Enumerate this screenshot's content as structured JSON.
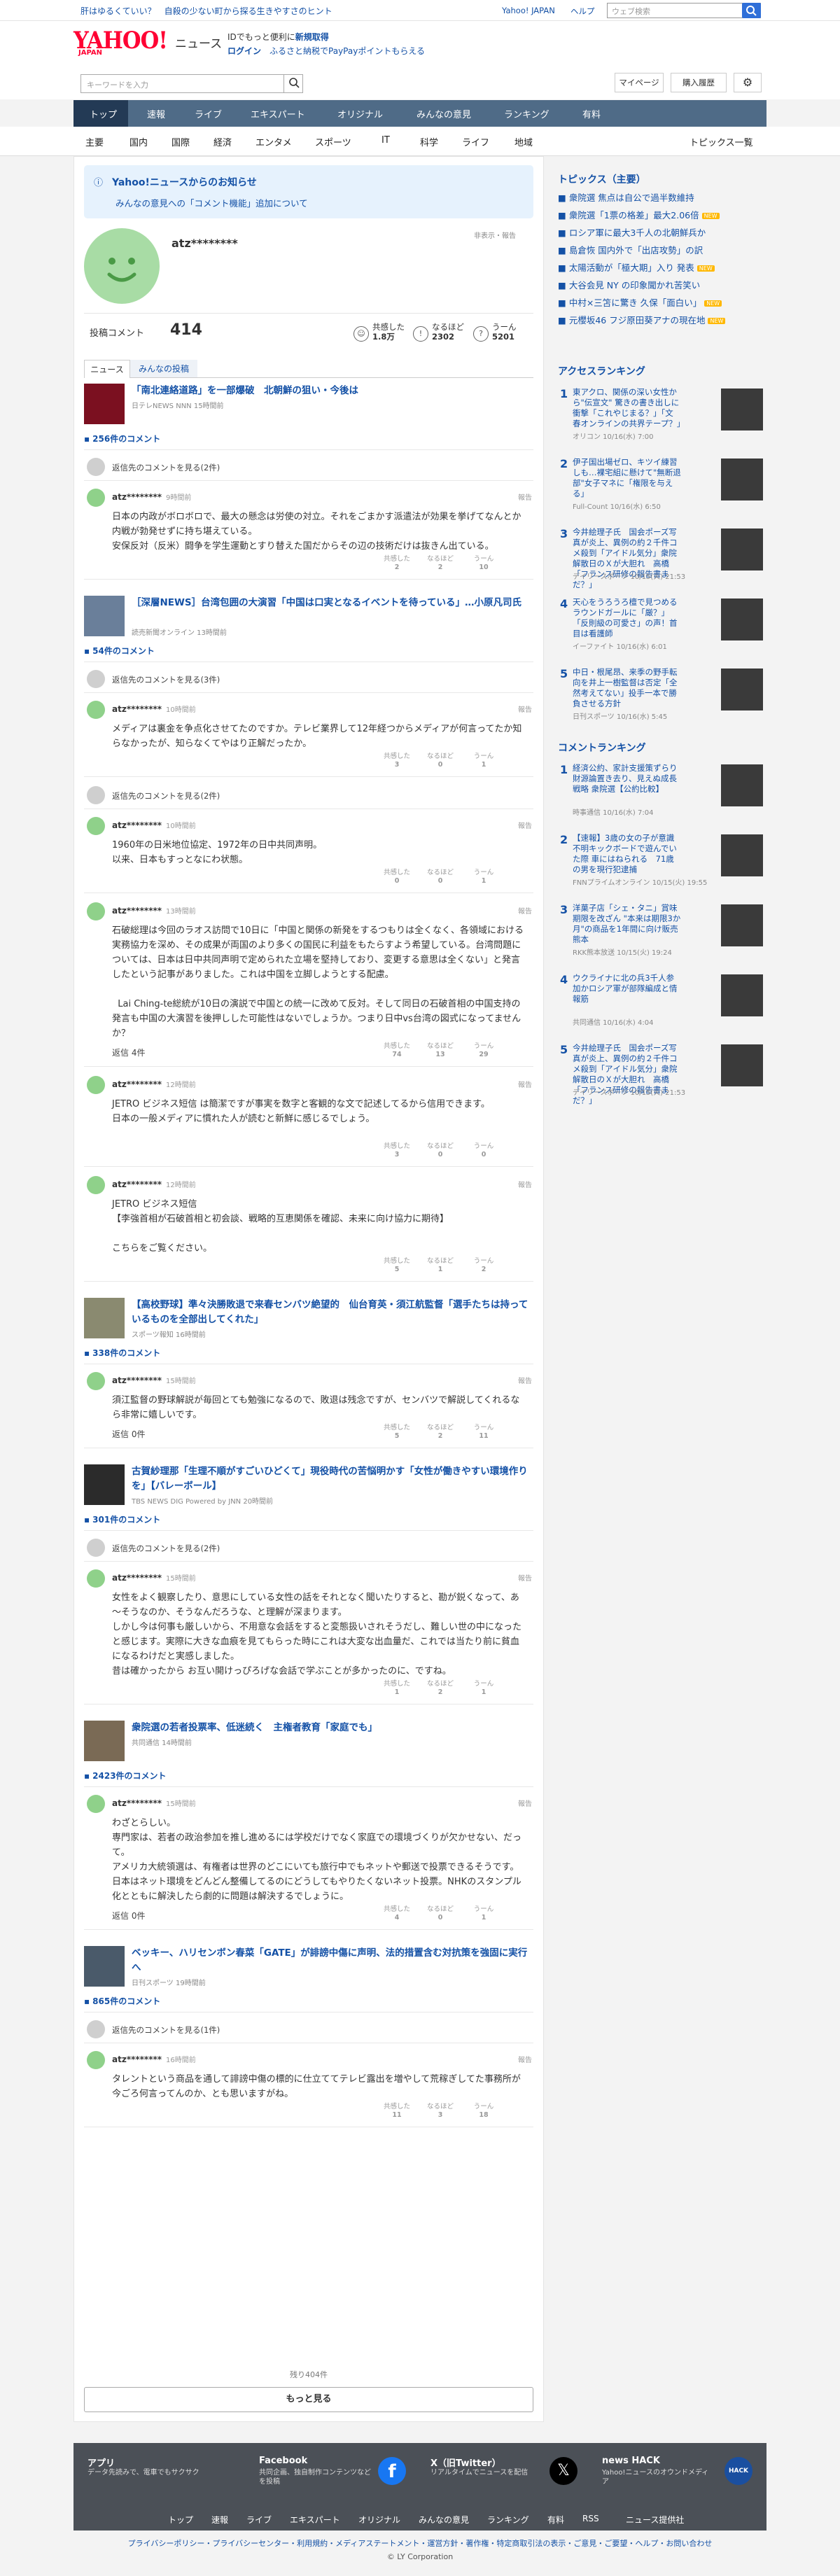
{
  "topbar": {
    "promo": "肝はゆるくていい？　自殺の少ない町から探る生きやすさのヒント",
    "yjapan": "Yahoo! JAPAN",
    "help": "ヘルプ",
    "search_placeholder": "ウェブ検索"
  },
  "header": {
    "logo": "YAHOO!",
    "logo_sub": "JAPAN",
    "section": "ニュース",
    "promo1_a": "IDでもっと便利に",
    "promo1_b": "新規取得",
    "promo2_a": "ログイン",
    "promo2_b": "ふるさと納税でPayPayポイントもらえる"
  },
  "search": {
    "placeholder": "キーワードを入力",
    "mypage": "マイページ",
    "history": "購入履歴"
  },
  "nav": [
    "トップ",
    "速報",
    "ライブ",
    "エキスパート",
    "オリジナル",
    "みんなの意見",
    "ランキング",
    "有料"
  ],
  "subnav": [
    "主要",
    "国内",
    "国際",
    "経済",
    "エンタメ",
    "スポーツ",
    "IT",
    "科学",
    "ライフ",
    "地域"
  ],
  "subnav_right": "トピックス一覧",
  "notice": {
    "title": "Yahoo!ニュースからのお知らせ",
    "body": "みんなの意見への「コメント機能」追加について"
  },
  "profile": {
    "name": "atz********",
    "hide": "非表示・報告",
    "comments_label": "投稿コメント",
    "comments": "414",
    "stats": [
      {
        "label": "共感した",
        "value": "1.8万"
      },
      {
        "label": "なるほど",
        "value": "2302"
      },
      {
        "label": "うーん",
        "value": "5201"
      }
    ]
  },
  "tabs": [
    "ニュース",
    "みんなの投稿"
  ],
  "articles": [
    {
      "title": "「南北連絡道路」を一部爆破　北朝鮮の狙い・今後は",
      "src": "日テレNEWS NNN 15時間前",
      "count": "256件のコメント",
      "replies_see": "返信先のコメントを見る(2件)",
      "comments": [
        {
          "name": "atz********",
          "time": "9時間前",
          "text": "日本の内政がボロボロで、最大の懸念は労使の対立。それをごまかす派遣法が効果を挙げてなんとか内戦が勃発せずに持ち堪えている。\n安保反対（反米）闘争を学生運動とすり替えた国だからその辺の技術だけは抜きん出ている。",
          "r": [
            "2",
            "2",
            "10"
          ]
        }
      ]
    },
    {
      "title": "［深層NEWS］台湾包囲の大演習「中国は口実となるイベントを待っている」…小原凡司氏",
      "src": "読売新聞オンライン 13時間前",
      "count": "54件のコメント",
      "replies_see": "返信先のコメントを見る(3件)",
      "comments": [
        {
          "name": "atz********",
          "time": "10時間前",
          "text": "メディアは裏金を争点化させてたのですか。テレビ業界して12年経つからメディアが何言ってたか知らなかったが、知らなくてやはり正解だったか。",
          "r": [
            "3",
            "0",
            "1"
          ]
        }
      ],
      "replies_see2": "返信先のコメントを見る(2件)",
      "comments2": [
        {
          "name": "atz********",
          "time": "10時間前",
          "text": "1960年の日米地位協定、1972年の日中共同声明。\n以来、日本もすっとなにわ状態。",
          "r": [
            "0",
            "0",
            "1"
          ]
        },
        {
          "name": "atz********",
          "time": "13時間前",
          "text": "石破総理は今回のラオス訪問で10日に「中国と関係の新発をするつもりは全くなく、各領域における実務協力を深め、その成果が両国のより多くの国民に利益をもたらすよう希望している。台湾問題については、日本は日中共同声明で定められた立場を堅持しており、変更する意思は全くない」と発言したという記事がありました。これは中国を立脚しようとする配慮。\n\n  Lai Ching-te総統が10日の演説で中国との統一に改めて反対。そして同日の石破首相の中国支持の発言も中国の大演習を後押しした可能性はないでしょうか。つまり日中vs台湾の図式になってませんか？",
          "r": [
            "74",
            "13",
            "29"
          ],
          "replies": "返信 4件"
        },
        {
          "name": "atz********",
          "time": "12時間前",
          "text": "JETRO ビジネス短信 は簡潔ですが事実を数字と客観的な文で記述してるから信用できます。\n日本の一般メディアに慣れた人が読むと新鮮に感じるでしょう。",
          "r": [
            "3",
            "0",
            "0"
          ]
        },
        {
          "name": "atz********",
          "time": "12時間前",
          "text": "JETRO ビジネス短信\n【李強首相が石破首相と初会談、戦略的互恵関係を確認、未来に向け協力に期待】\n\nこちらをご覧ください。",
          "r": [
            "5",
            "1",
            "2"
          ]
        }
      ]
    },
    {
      "title": "【高校野球】準々決勝敗退で来春センバツ絶望的　仙台育英・須江航監督「選手たちは持っているものを全部出してくれた」",
      "src": "スポーツ報知 16時間前",
      "count": "338件のコメント",
      "comments": [
        {
          "name": "atz********",
          "time": "15時間前",
          "text": "須江監督の野球解説が毎回とても勉強になるので、敗退は残念ですが、センバツで解説してくれるなら非常に嬉しいです。",
          "r": [
            "5",
            "2",
            "11"
          ],
          "replies": "返信 0件"
        }
      ]
    },
    {
      "title": "古賀紗理那「生理不順がすごいひどくて」現役時代の苦悩明かす「女性が働きやすい環境作りを」【バレーボール】",
      "src": "TBS NEWS DIG Powered by JNN 20時間前",
      "count": "301件のコメント",
      "replies_see": "返信先のコメントを見る(2件)",
      "comments": [
        {
          "name": "atz********",
          "time": "15時間前",
          "text": "女性をよく観察したり、意思にしている女性の話をそれとなく聞いたりすると、勘が鋭くなって、あ～そうなのか、そうなんだろうな、と理解が深まります。\nしかし今は何事も厳しいから、不用意な会話をすると変態扱いされそうだし、難しい世の中になったと感じます。実際に大きな血痕を見てもらった時にこれは大変な出血量だ、これでは当たり前に貧血になるわけだと実感しました。\n昔は確かったから お互い開けっぴろげな会話で学ぶことが多かったのに、ですね。",
          "r": [
            "1",
            "2",
            "1"
          ]
        }
      ]
    },
    {
      "title": "衆院選の若者投票率、低迷続く　主権者教育「家庭でも」",
      "src": "共同通信 14時間前",
      "count": "2423件のコメント",
      "comments": [
        {
          "name": "atz********",
          "time": "15時間前",
          "text": "わざとらしい。\n専門家は、若者の政治参加を推し進めるには学校だけでなく家庭での環境づくりが欠かせない、だって。\nアメリカ大統領選は、有権者は世界のどこにいても旅行中でもネットや郵送で投票できるそうです。日本はネット環境をどんどん整備してるのにどうしてもやりたくないネット投票。NHKのスタンプル化とともに解決したら劇的に問題は解決するでしょうに。",
          "r": [
            "4",
            "0",
            "1"
          ],
          "replies": "返信 0件"
        }
      ]
    },
    {
      "title": "ベッキー、ハリセンボン春菜「GATE」が誹謗中傷に声明、法的措置含む対抗策を強固に実行へ",
      "src": "日刊スポーツ 19時間前",
      "count": "865件のコメント",
      "replies_see": "返信先のコメントを見る(1件)",
      "comments": [
        {
          "name": "atz********",
          "time": "16時間前",
          "text": "タレントという商品を通して誹謗中傷の標的に仕立ててテレビ露出を増やして荒稼ぎしてた事務所が今ごろ何言ってんのか、とも思いますがね。",
          "r": [
            "11",
            "3",
            "18"
          ]
        }
      ]
    }
  ],
  "reactions": [
    "共感した",
    "なるほど",
    "うーん"
  ],
  "report": "報告",
  "rest": "残り404件",
  "more": "もっと見る",
  "side": {
    "topics_head": "トピックス（主要）",
    "topics": [
      "衆院選 焦点は自公で過半数維持",
      "衆院選「1票の格差」最大2.06倍",
      "ロシア軍に最大3千人の北朝鮮兵か",
      "島倉恢 国内外で「出店攻勢」の訳",
      "太陽活動が「極大期」入り 発表",
      "大谷会見 NY の印象聞かれ苦笑い",
      "中村×三笘に驚き 久保「面白い」",
      "元櫻坂46 フジ原田葵アナの現在地"
    ],
    "topics_new": [
      false,
      true,
      false,
      false,
      true,
      false,
      true,
      true
    ],
    "access_head": "アクセスランキング",
    "access": [
      {
        "t": "東アクロ、関係の深い女性から\"伝宣文\" 驚きの書き出しに衝撃「これやじまる？」「文春オンラインの共界テープ？」",
        "s": "オリコン 10/16(水) 7:00"
      },
      {
        "t": "伊子国出場ゼロ、キツイ練習しも…裸宅組に懸けて\"無断退部\"女子マネに「権限を与える」",
        "s": "Full-Count 10/16(水) 6:50"
      },
      {
        "t": "今井絵理子氏　国会ポーズ写真が炎上、異例の約２千件コメ殺到「アイドル気分」衆院解散日のＸが大胆れ　高橋「フランス研修の報告書まだ？」",
        "s": "デイリースポーツ 10/15(火) 21:53"
      },
      {
        "t": "天心をうろうろ檀で見つめるラウンドガールに「厳？」「反則級の可愛さ」の声！首目は看護師",
        "s": "イーファイト 10/16(水) 6:01"
      },
      {
        "t": "中日・根尾昂、来季の野手転向を井上一樹監督は否定「全然考えてない」投手一本で勝負させる方針",
        "s": "日刊スポーツ 10/16(水) 5:45"
      }
    ],
    "comment_head": "コメントランキング",
    "comment": [
      {
        "t": "経済公約、家計支援策ずらり　財源論置き去り、見えぬ成長戦略 衆院選【公約比較】",
        "s": "時事通信 10/16(水) 7:04"
      },
      {
        "t": "【速報】3歳の女の子が意識不明キックボードで遊んでいた際 車にはねられる　71歳の男を現行犯逮捕",
        "s": "FNNプライムオンライン 10/15(火) 19:55"
      },
      {
        "t": "洋菓子店「シェ・タニ」賞味期限を改ざん \"本来は期限3か月\"の商品を1年間に向け販売 熊本",
        "s": "RKK熊本放送 10/15(火) 19:24"
      },
      {
        "t": "ウクライナに北の兵3千人参加かロシア軍が部隊編成と情報筋",
        "s": "共同通信 10/16(水) 4:04"
      },
      {
        "t": "今井絵理子氏　国会ポーズ写真が炎上、異例の約２千件コメ殺到「アイドル気分」衆院解散日のＸが大胆れ　高橋「フランス研修の報告書まだ？」",
        "s": "デイリースポーツ 10/15(火) 21:53"
      }
    ]
  },
  "footer": {
    "blocks": [
      {
        "t": "アプリ",
        "d": "データ先読みで、電車でもサクサク"
      },
      {
        "t": "Facebook",
        "d": "共同企画、独自制作コンテンツなどを投稿"
      },
      {
        "t": "X（旧Twitter）",
        "d": "リアルタイムでニュースを配信"
      },
      {
        "t": "news HACK",
        "d": "Yahoo!ニュースのオウンドメディア"
      }
    ],
    "nav": [
      "トップ",
      "速報",
      "ライブ",
      "エキスパート",
      "オリジナル",
      "みんなの意見",
      "ランキング",
      "有料",
      "RSS",
      "ニュース提供社"
    ],
    "links": "プライバシーポリシー・プライバシーセンター・利用規約・メディアステートメント・運営方針・著作権・特定商取引法の表示・ご意見・ご要望・ヘルプ・お問い合わせ",
    "copy": "© LY Corporation"
  }
}
